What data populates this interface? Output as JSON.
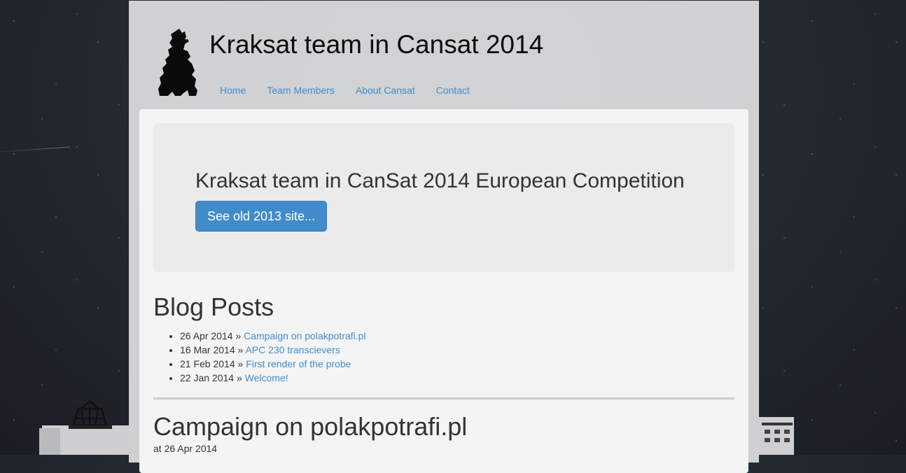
{
  "site": {
    "title": "Kraksat team in Cansat 2014"
  },
  "nav": {
    "items": [
      {
        "label": "Home"
      },
      {
        "label": "Team Members"
      },
      {
        "label": "About Cansat"
      },
      {
        "label": "Contact"
      }
    ]
  },
  "jumbotron": {
    "heading": "Kraksat team in CanSat 2014 European Competition",
    "button_label": "See old 2013 site..."
  },
  "blog": {
    "heading": "Blog Posts",
    "separator": "»",
    "posts": [
      {
        "date": "26 Apr 2014",
        "title": "Campaign on polakpotrafi.pl"
      },
      {
        "date": "16 Mar 2014",
        "title": "APC 230 transcievers"
      },
      {
        "date": "21 Feb 2014",
        "title": "First render of the probe"
      },
      {
        "date": "22 Jan 2014",
        "title": "Welcome!"
      }
    ]
  },
  "latest_post": {
    "title": "Campaign on polakpotrafi.pl",
    "date_line": "at 26 Apr 2014"
  },
  "colors": {
    "link": "#428bca",
    "button": "#428bca"
  }
}
